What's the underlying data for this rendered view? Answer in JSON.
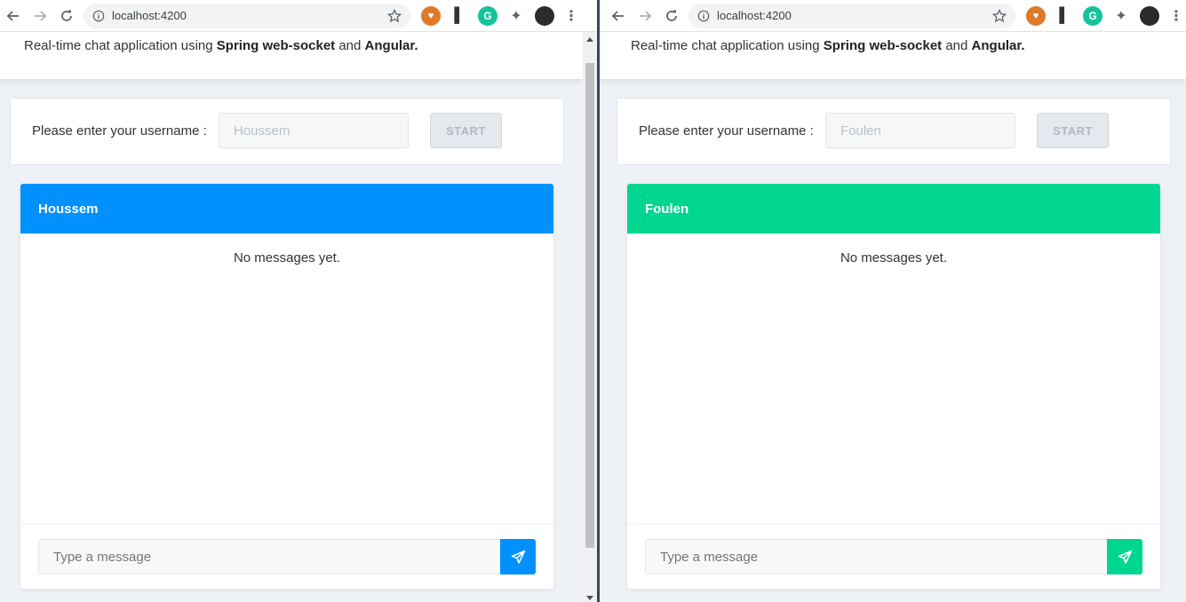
{
  "browser": {
    "url": "localhost:4200",
    "extensions": [
      {
        "icon": "shield-extension-icon",
        "glyph": "♥"
      },
      {
        "icon": "phone-extension-icon",
        "glyph": "▌"
      },
      {
        "icon": "grammarly-icon",
        "glyph": "G"
      },
      {
        "icon": "puzzle-extensions-icon",
        "glyph": "✦"
      }
    ],
    "menu_glyph": "⋮"
  },
  "page": {
    "tagline_prefix": "Real-time chat application using ",
    "tagline_bold1": "Spring web-socket",
    "tagline_and": " and ",
    "tagline_bold2": "Angular.",
    "username_label": "Please enter your username :",
    "start_label": "START",
    "empty_messages": "No messages yet.",
    "message_placeholder": "Type a message"
  },
  "windows": [
    {
      "username_value": "Houssem",
      "chat_title": "Houssem",
      "accent": "#0091ff"
    },
    {
      "username_value": "Foulen",
      "chat_title": "Foulen",
      "accent": "#00d68f"
    }
  ]
}
